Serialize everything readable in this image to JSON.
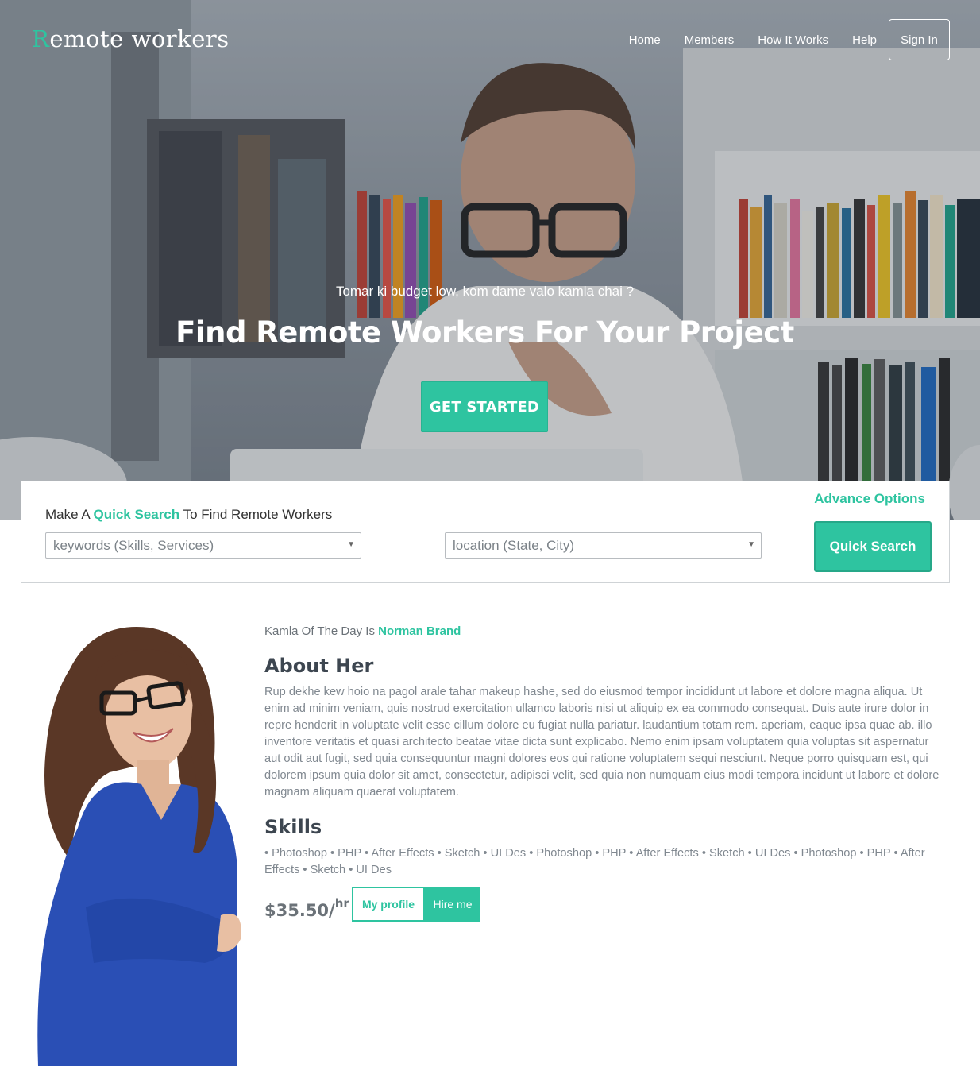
{
  "header": {
    "logo_first": "R",
    "logo_rest": "emote workers",
    "nav": [
      "Home",
      "Members",
      "How It Works",
      "Help"
    ],
    "signin": "Sign In"
  },
  "hero": {
    "tagline": "Tomar ki budget low, kom dame valo kamla chai ?",
    "headline": "Find Remote Workers For Your Project",
    "cta": "GET STARTED"
  },
  "search": {
    "title_pre": "Make A ",
    "title_highlight": "Quick Search",
    "title_post": " To Find Remote Workers",
    "advance": "Advance Options",
    "keywords_placeholder": "keywords (Skills, Services)",
    "location_placeholder": "location (State, City)",
    "button": "Quick Search"
  },
  "profile": {
    "kotd_label": "Kamla Of The Day Is ",
    "kotd_name": "Norman Brand",
    "about_heading": "About Her",
    "about_text": "Rup dekhe kew hoio na pagol arale tahar makeup hashe, sed do eiusmod tempor incididunt ut labore et dolore magna aliqua. Ut enim ad minim veniam, quis nostrud exercitation ullamco laboris nisi ut aliquip ex ea commodo consequat. Duis aute irure dolor in repre henderit in voluptate velit esse cillum dolore eu fugiat nulla pariatur. laudantium totam rem. aperiam, eaque ipsa quae ab. illo inventore veritatis et quasi architecto beatae vitae dicta sunt explicabo. Nemo enim ipsam voluptatem quia voluptas sit aspernatur aut odit aut fugit, sed quia consequuntur magni dolores eos qui ratione voluptatem sequi nesciunt. Neque porro quisquam est, qui dolorem ipsum quia dolor sit amet, consectetur, adipisci velit, sed quia non numquam eius modi tempora incidunt ut labore et dolore magnam aliquam quaerat voluptatem.",
    "skills_heading": "Skills",
    "skills_text": "• Photoshop • PHP • After Effects • Sketch • UI Des • Photoshop • PHP • After Effects • Sketch • UI Des • Photoshop • PHP • After Effects • Sketch • UI Des",
    "rate": "$35.50/",
    "rate_unit": "hr",
    "my_profile": "My profile",
    "hire_me": "Hire me"
  },
  "icons": {
    "select_arrow": "chevron-down-icon"
  },
  "colors": {
    "accent": "#2ec4a0",
    "heading": "#3d4650",
    "body_text": "#808890"
  }
}
